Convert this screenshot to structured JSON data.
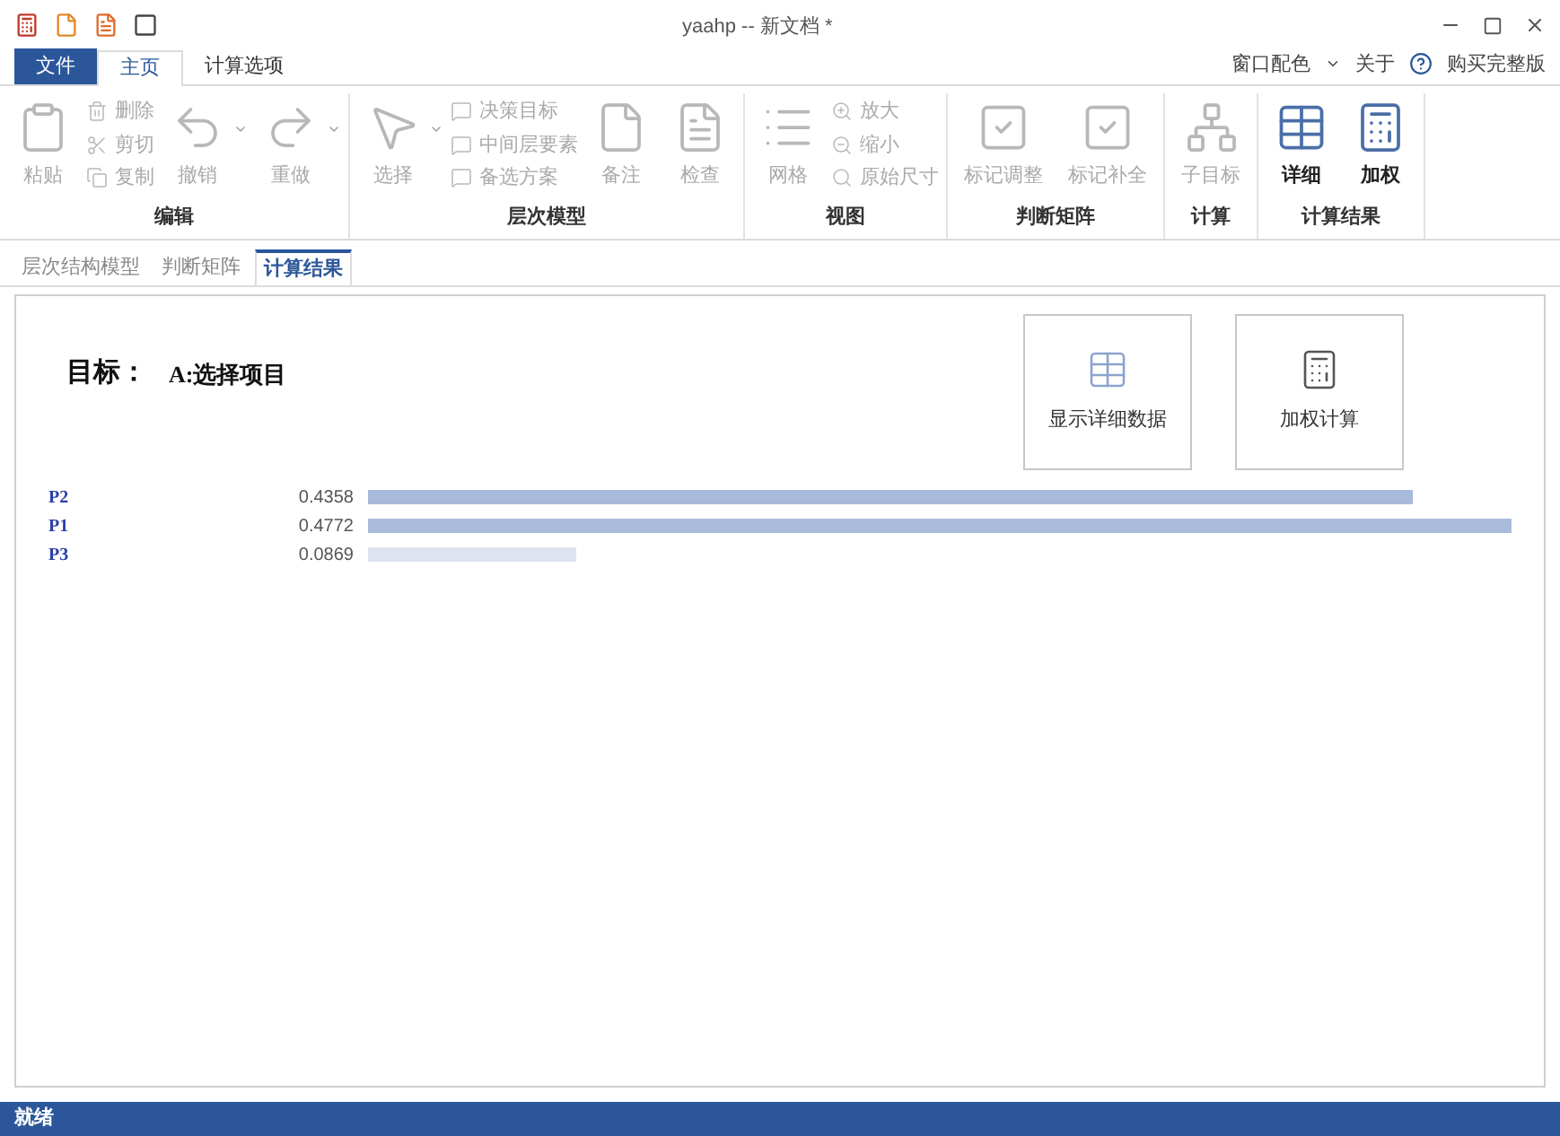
{
  "window": {
    "title": "yaahp -- 新文档 *"
  },
  "menu_tabs": [
    {
      "label": "文件",
      "kind": "file",
      "selected": false
    },
    {
      "label": "主页",
      "kind": "tab",
      "selected": true
    },
    {
      "label": "计算选项",
      "kind": "tab",
      "selected": false
    }
  ],
  "right_menu": {
    "color_scheme": "窗口配色",
    "about": "关于",
    "buy": "购买完整版"
  },
  "ribbon": [
    {
      "label": "编辑",
      "items": [
        {
          "kind": "large",
          "label": "粘贴",
          "disabled": true,
          "dropdown": false
        },
        {
          "kind": "stack",
          "items": [
            {
              "label": "删除",
              "disabled": true
            },
            {
              "label": "剪切",
              "disabled": true
            },
            {
              "label": "复制",
              "disabled": true
            }
          ]
        },
        {
          "kind": "large",
          "label": "撤销",
          "disabled": true,
          "dropdown": true
        },
        {
          "kind": "large",
          "label": "重做",
          "disabled": true,
          "dropdown": true
        }
      ]
    },
    {
      "label": "层次模型",
      "items": [
        {
          "kind": "large",
          "label": "选择",
          "disabled": true,
          "dropdown": true
        },
        {
          "kind": "stack",
          "items": [
            {
              "label": "决策目标",
              "disabled": true
            },
            {
              "label": "中间层要素",
              "disabled": true
            },
            {
              "label": "备选方案",
              "disabled": true
            }
          ]
        },
        {
          "kind": "large",
          "label": "备注",
          "disabled": true,
          "dropdown": false
        },
        {
          "kind": "large",
          "label": "检查",
          "disabled": true,
          "dropdown": false
        }
      ]
    },
    {
      "label": "视图",
      "items": [
        {
          "kind": "large",
          "label": "网格",
          "disabled": true,
          "dropdown": false
        },
        {
          "kind": "stack",
          "items": [
            {
              "label": "放大",
              "disabled": true
            },
            {
              "label": "缩小",
              "disabled": true
            },
            {
              "label": "原始尺寸",
              "disabled": true
            }
          ]
        }
      ]
    },
    {
      "label": "判断矩阵",
      "items": [
        {
          "kind": "large",
          "label": "标记调整",
          "disabled": true,
          "dropdown": false
        },
        {
          "kind": "large",
          "label": "标记补全",
          "disabled": true,
          "dropdown": false
        }
      ]
    },
    {
      "label": "计算",
      "items": [
        {
          "kind": "large",
          "label": "子目标",
          "disabled": true,
          "dropdown": false
        }
      ]
    },
    {
      "label": "计算结果",
      "items": [
        {
          "kind": "large",
          "label": "详细",
          "disabled": false,
          "dropdown": false
        },
        {
          "kind": "large",
          "label": "加权",
          "disabled": false,
          "dropdown": false
        }
      ]
    }
  ],
  "doc_tabs": [
    {
      "label": "层次结构模型",
      "selected": false
    },
    {
      "label": "判断矩阵",
      "selected": false
    },
    {
      "label": "计算结果",
      "selected": true
    }
  ],
  "goal": {
    "label": "目标：",
    "value": "A:选择项目"
  },
  "action_buttons": [
    {
      "label": "显示详细数据"
    },
    {
      "label": "加权计算"
    }
  ],
  "results": [
    {
      "name": "P2",
      "value": "0.4358",
      "color": "#a8bbdb"
    },
    {
      "name": "P1",
      "value": "0.4772",
      "color": "#a8bbdb"
    },
    {
      "name": "P3",
      "value": "0.0869",
      "color": "#dde3ef"
    }
  ],
  "status_bar": "就绪"
}
